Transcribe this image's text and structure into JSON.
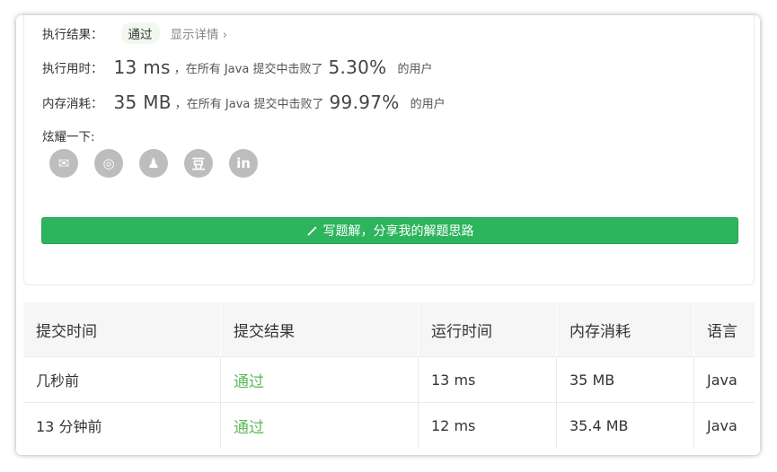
{
  "result": {
    "label": "执行结果：",
    "status": "通过",
    "detail_link": "显示详情 ›"
  },
  "runtime": {
    "label": "执行用时：",
    "value": "13 ms",
    "mid_text": "，在所有 Java 提交中击败了",
    "percent": "5.30%",
    "suffix": "的用户"
  },
  "memory": {
    "label": "内存消耗：",
    "value": "35 MB",
    "mid_text": "，在所有 Java 提交中击败了",
    "percent": "99.97%",
    "suffix": "的用户"
  },
  "share": {
    "label": "炫耀一下:",
    "icons": [
      {
        "name": "wechat-icon",
        "glyph": "✉"
      },
      {
        "name": "weibo-icon",
        "glyph": "◎"
      },
      {
        "name": "qq-icon",
        "glyph": "♟"
      },
      {
        "name": "douban-icon",
        "glyph": "豆"
      },
      {
        "name": "linkedin-icon",
        "glyph": "in"
      }
    ]
  },
  "cta": {
    "label": "写题解，分享我的解题思路",
    "icon": "pencil-icon"
  },
  "table": {
    "headers": [
      "提交时间",
      "提交结果",
      "运行时间",
      "内存消耗",
      "语言"
    ],
    "rows": [
      [
        "几秒前",
        "通过",
        "13 ms",
        "35 MB",
        "Java"
      ],
      [
        "13 分钟前",
        "通过",
        "12 ms",
        "35.4 MB",
        "Java"
      ]
    ]
  },
  "colors": {
    "accent": "#2db55d",
    "pass": "#5cb85c",
    "icon_gray": "#bdbdbd"
  }
}
